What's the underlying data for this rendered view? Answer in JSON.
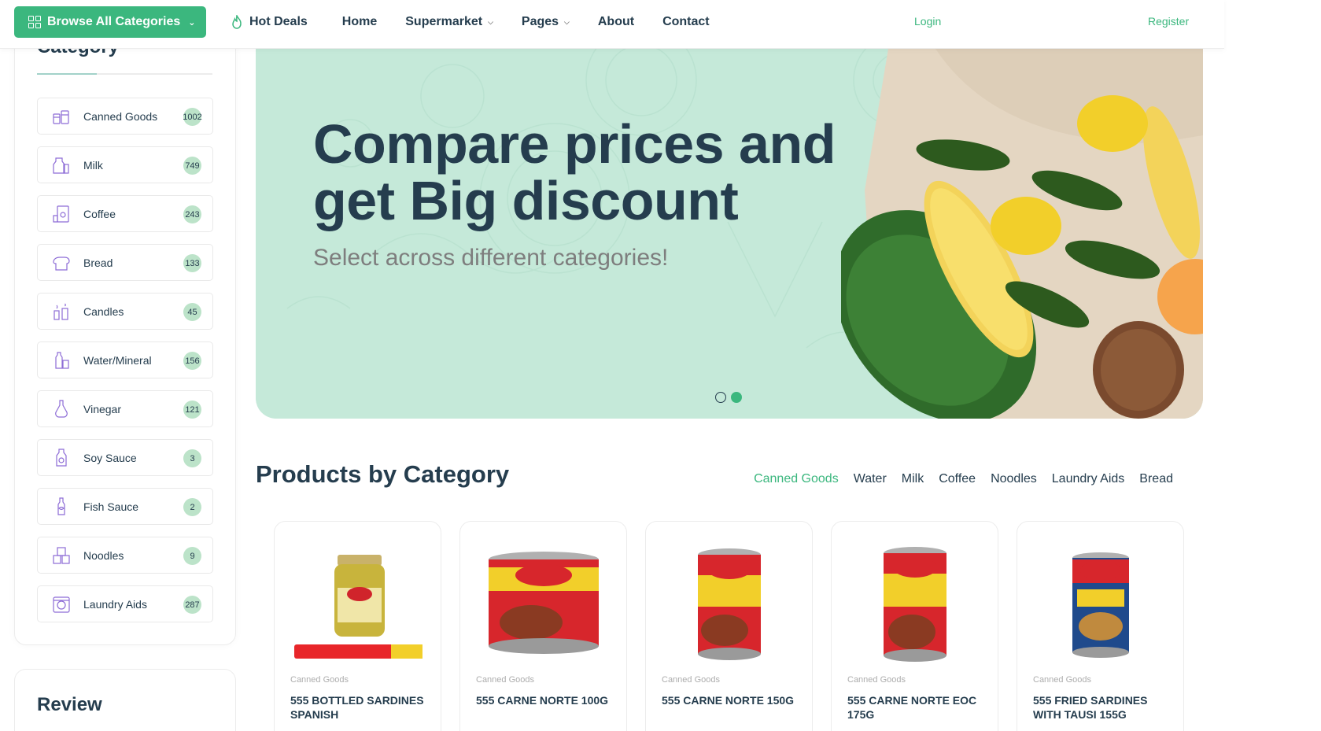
{
  "header": {
    "browse_label": "Browse All Categories",
    "nav": [
      {
        "label": "Hot Deals",
        "has_caret": false
      },
      {
        "label": "Home",
        "has_caret": false
      },
      {
        "label": "Supermarket",
        "has_caret": true
      },
      {
        "label": "Pages",
        "has_caret": true
      },
      {
        "label": "About",
        "has_caret": false
      },
      {
        "label": "Contact",
        "has_caret": false
      }
    ],
    "login": "Login",
    "register": "Register"
  },
  "sidebar": {
    "title": "Category",
    "items": [
      {
        "label": "Canned Goods",
        "count": "1002",
        "icon": "canned-goods-icon"
      },
      {
        "label": "Milk",
        "count": "749",
        "icon": "milk-icon"
      },
      {
        "label": "Coffee",
        "count": "243",
        "icon": "coffee-icon"
      },
      {
        "label": "Bread",
        "count": "133",
        "icon": "bread-icon"
      },
      {
        "label": "Candles",
        "count": "45",
        "icon": "candles-icon"
      },
      {
        "label": "Water/Mineral",
        "count": "156",
        "icon": "water-icon"
      },
      {
        "label": "Vinegar",
        "count": "121",
        "icon": "vinegar-icon"
      },
      {
        "label": "Soy Sauce",
        "count": "3",
        "icon": "soy-sauce-icon"
      },
      {
        "label": "Fish Sauce",
        "count": "2",
        "icon": "fish-sauce-icon"
      },
      {
        "label": "Noodles",
        "count": "9",
        "icon": "noodles-icon"
      },
      {
        "label": "Laundry Aids",
        "count": "287",
        "icon": "laundry-icon"
      }
    ],
    "review_title": "Review"
  },
  "hero": {
    "title": "Compare prices and get Big discount",
    "subtitle": "Select across different categories!",
    "slides": 2,
    "active_slide": 2
  },
  "products_section": {
    "title": "Products by Category",
    "tabs": [
      "Canned Goods",
      "Water",
      "Milk",
      "Coffee",
      "Noodles",
      "Laundry Aids",
      "Bread"
    ],
    "active_tab": "Canned Goods",
    "products": [
      {
        "category": "Canned Goods",
        "name": "555 Bottled Sardines Spanish",
        "image": "sardines-jar"
      },
      {
        "category": "Canned Goods",
        "name": "555 Carne Norte 100g",
        "image": "carne-norte-can-wide"
      },
      {
        "category": "Canned Goods",
        "name": "555 Carne Norte 150g",
        "image": "carne-norte-can-tall"
      },
      {
        "category": "Canned Goods",
        "name": "555 Carne Norte EOC 175g",
        "image": "carne-norte-can-tall"
      },
      {
        "category": "Canned Goods",
        "name": "555 Fried Sardines with Tausi 155g",
        "image": "fried-sardines-can"
      }
    ]
  },
  "colors": {
    "brand": "#3bb77e",
    "heading": "#253d4e",
    "hero_bg": "#c5e9d9",
    "badge_bg": "#bce3c9"
  }
}
